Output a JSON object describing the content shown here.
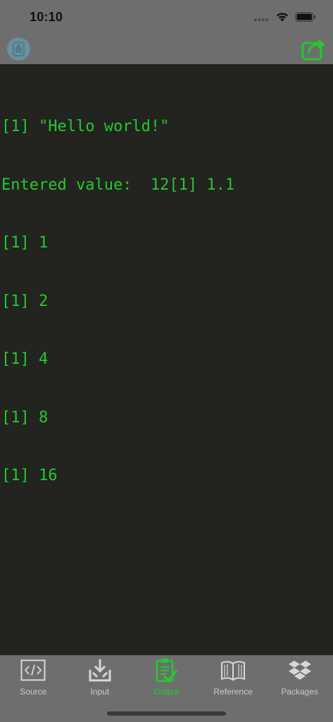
{
  "status_bar": {
    "time": "10:10"
  },
  "console": {
    "lines": [
      "[1] \"Hello world!\"",
      "Entered value:  12[1] 1.1",
      "[1] 1",
      "[1] 2",
      "[1] 4",
      "[1] 8",
      "[1] 16"
    ]
  },
  "tabbar": {
    "tabs": [
      {
        "label": "Source",
        "icon": "code-icon",
        "active": false
      },
      {
        "label": "Input",
        "icon": "download-tray-icon",
        "active": false
      },
      {
        "label": "Output",
        "icon": "clipboard-check-icon",
        "active": true
      },
      {
        "label": "Reference",
        "icon": "open-book-icon",
        "active": false
      },
      {
        "label": "Packages",
        "icon": "dropbox-box-icon",
        "active": false
      }
    ]
  },
  "colors": {
    "accent_green": "#1fcc2a",
    "background": "#232320",
    "bars": "#6e6e6e",
    "inactive_label": "#c8c8c8"
  }
}
